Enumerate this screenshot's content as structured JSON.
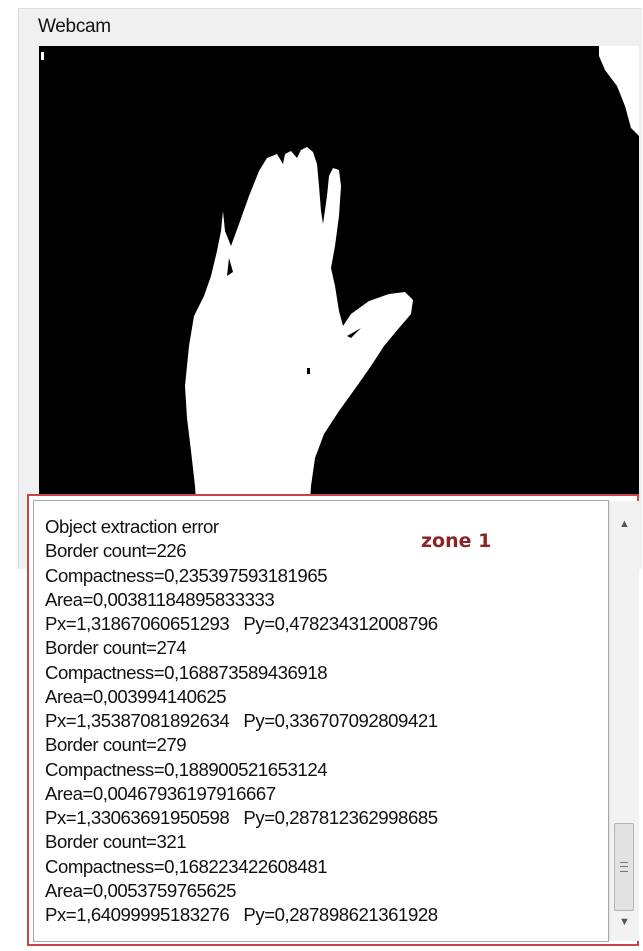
{
  "groupbox": {
    "title": "Webcam"
  },
  "webcam": {
    "description_icon": "webcam-binary-hand-image"
  },
  "annotation": {
    "label": "zone 1",
    "color": "#c8444c"
  },
  "log": {
    "lines": [
      "Object extraction error",
      "Border count=226",
      "Compactness=0,235397593181965",
      "Area=0,00381184895833333",
      "Px=1,31867060651293   Py=0,478234312008796",
      "Border count=274",
      "Compactness=0,168873589436918",
      "Area=0,003994140625",
      "Px=1,35387081892634   Py=0,336707092809421",
      "Border count=279",
      "Compactness=0,188900521653124",
      "Area=0,00467936197916667",
      "Px=1,33063691950598   Py=0,287812362998685",
      "Border count=321",
      "Compactness=0,168223422608481",
      "Area=0,0053759765625",
      "Px=1,64099995183276   Py=0,287898621361928"
    ]
  },
  "scrollbar": {
    "up_icon": "scroll-up-arrow-icon",
    "down_icon": "scroll-down-arrow-icon",
    "position": 0.82
  }
}
